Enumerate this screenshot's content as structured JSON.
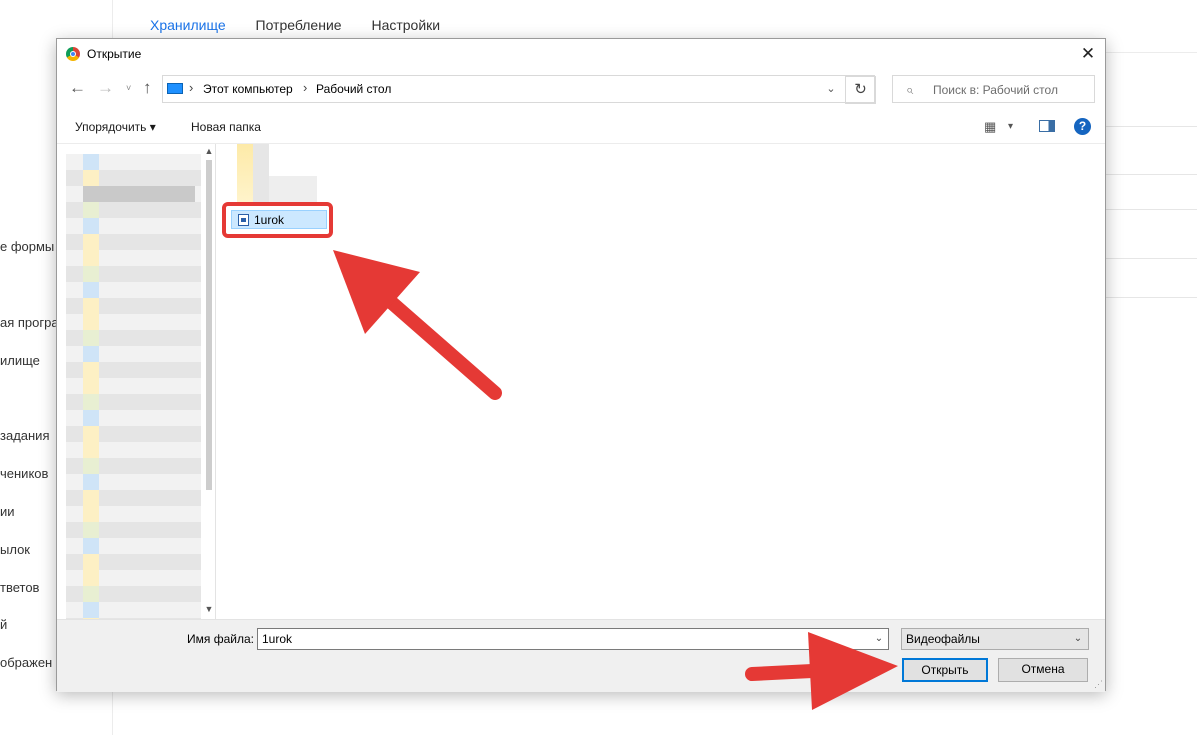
{
  "background": {
    "tabs": [
      {
        "label": "Хранилище",
        "active": true
      },
      {
        "label": "Потребление",
        "active": false
      },
      {
        "label": "Настройки",
        "active": false
      }
    ],
    "sidebar_items": [
      "е формы",
      "ая програ",
      "илище",
      "задания",
      "чеников",
      "ии",
      "ылок",
      "тветов",
      "й",
      "ображен"
    ]
  },
  "dialog": {
    "title": "Открытие",
    "close_glyph": "✕",
    "nav": {
      "back_glyph": "←",
      "forward_glyph": "→",
      "recent_glyph": "˅",
      "up_glyph": "↑",
      "breadcrumbs": [
        "Этот компьютер",
        "Рабочий стол"
      ],
      "crumb_separator": "›",
      "dropdown_glyph": "⌄",
      "refresh_glyph": "↻",
      "search_placeholder": "Поиск в: Рабочий стол",
      "search_icon": "⌕"
    },
    "toolbar": {
      "organize_label": "Упорядочить ▾",
      "new_folder_label": "Новая папка",
      "view_icon": "▦",
      "view_dd": "▾",
      "help_glyph": "?"
    },
    "files": [
      {
        "name": "1urok",
        "selected": true,
        "icon": "video-file-icon"
      }
    ],
    "bottom": {
      "filename_label": "Имя файла:",
      "filename_value": "1urok",
      "filetype_value": "Видеофайлы",
      "dd_glyph": "⌄",
      "open_label": "Открыть",
      "cancel_label": "Отмена",
      "grip_glyph": "⋰"
    }
  },
  "annotations": {
    "arrow_color": "#e53935"
  }
}
